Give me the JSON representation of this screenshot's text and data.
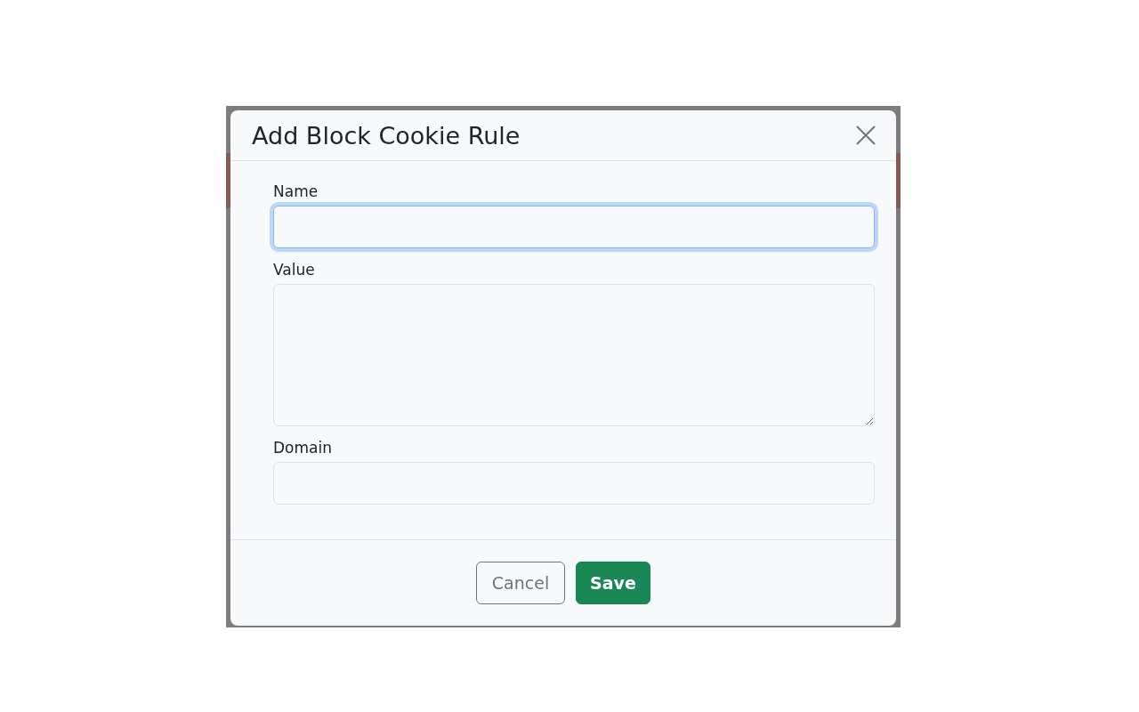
{
  "dialog": {
    "title": "Add Block Cookie Rule"
  },
  "fields": [
    {
      "kind": "input",
      "label": "Name",
      "focused": true
    },
    {
      "kind": "textarea",
      "label": "Value",
      "focused": false
    },
    {
      "kind": "input",
      "label": "Domain",
      "focused": false
    }
  ],
  "buttons": [
    {
      "label": "Cancel",
      "kind": "secondary"
    },
    {
      "label": "Save",
      "kind": "primary"
    }
  ]
}
